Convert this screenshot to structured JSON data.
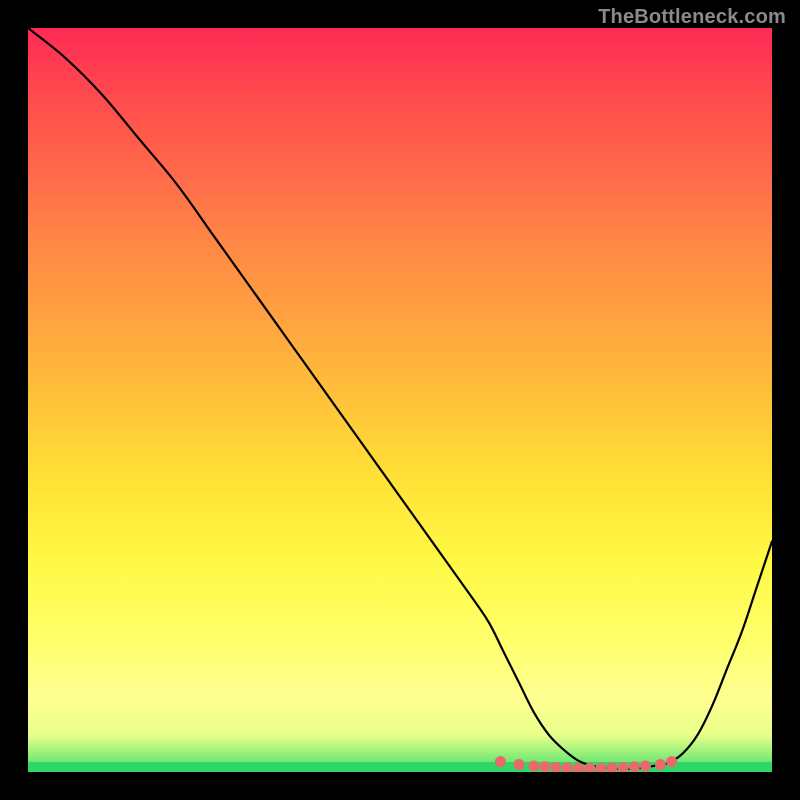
{
  "watermark": "TheBottleneck.com",
  "colors": {
    "background": "#000000",
    "curve": "#000000",
    "marker": "#e86a6a",
    "gradient_top": "#ff2a55",
    "gradient_bottom": "#44e06a"
  },
  "chart_data": {
    "type": "line",
    "title": "",
    "xlabel": "",
    "ylabel": "",
    "xlim": [
      0,
      100
    ],
    "ylim": [
      0,
      100
    ],
    "x": [
      0,
      5,
      10,
      15,
      20,
      25,
      30,
      35,
      40,
      45,
      50,
      55,
      60,
      62,
      64,
      66,
      68,
      70,
      72,
      74,
      76,
      78,
      80,
      82,
      84,
      86,
      88,
      90,
      92,
      94,
      96,
      98,
      100
    ],
    "values": [
      100,
      96,
      91,
      85,
      79,
      72,
      65,
      58,
      51,
      44,
      37,
      30,
      23,
      20,
      16,
      12,
      8,
      5,
      3,
      1.5,
      0.8,
      0.5,
      0.4,
      0.5,
      0.8,
      1.2,
      2.5,
      5,
      9,
      14,
      19,
      25,
      31
    ],
    "markers": {
      "x": [
        63.5,
        66,
        68,
        69.5,
        71,
        72.5,
        74,
        75.5,
        77,
        78.5,
        80,
        81.5,
        83,
        85,
        86.5
      ],
      "y": [
        1.4,
        1.0,
        0.8,
        0.7,
        0.6,
        0.55,
        0.5,
        0.5,
        0.5,
        0.55,
        0.6,
        0.7,
        0.8,
        1.0,
        1.4
      ]
    }
  }
}
